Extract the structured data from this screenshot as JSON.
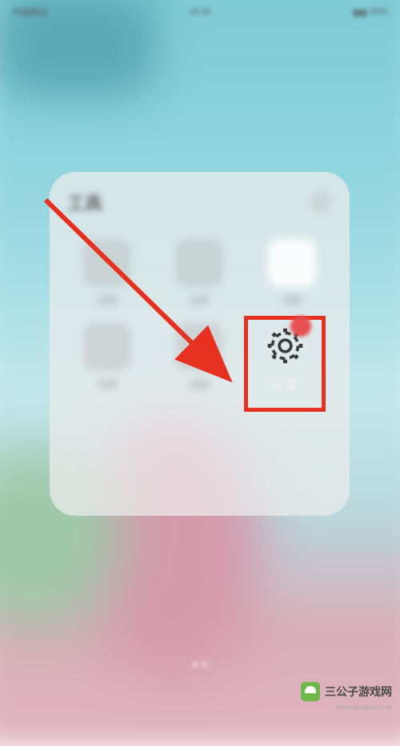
{
  "status_bar": {
    "carrier": "中国移动",
    "time": "16:30",
    "battery": "80%"
  },
  "folder": {
    "title": "工具",
    "apps": [
      {
        "label": "应用"
      },
      {
        "label": "应用"
      },
      {
        "label": "应用"
      },
      {
        "label": "应用"
      },
      {
        "label": "应用"
      }
    ]
  },
  "settings": {
    "label": "设置",
    "icon_name": "gear-icon"
  },
  "annotation": {
    "highlight_color": "#e63020",
    "arrow_color": "#e63020"
  },
  "watermark": {
    "text": "三公子游戏网",
    "url": "www.sangongzi.net"
  }
}
